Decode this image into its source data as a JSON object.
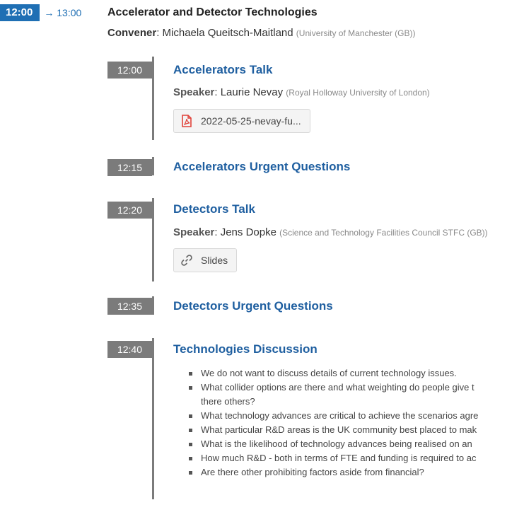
{
  "session": {
    "start": "12:00",
    "end": "→ 13:00",
    "title": "Accelerator and Detector Technologies",
    "convener_label": "Convener",
    "convener_name": "Michaela Queitsch-Maitland",
    "convener_affiliation": "(University of Manchester (GB))"
  },
  "contributions": [
    {
      "time": "12:00",
      "title": "Accelerators Talk",
      "speaker_label": "Speaker",
      "speaker_name": "Laurie Nevay",
      "speaker_affiliation": "(Royal Holloway University of London)",
      "attachment": {
        "label": "2022-05-25-nevay-fu...",
        "icon": "pdf-icon"
      }
    },
    {
      "time": "12:15",
      "title": "Accelerators Urgent Questions"
    },
    {
      "time": "12:20",
      "title": "Detectors Talk",
      "speaker_label": "Speaker",
      "speaker_name": "Jens Dopke",
      "speaker_affiliation": "(Science and Technology Facilities Council STFC (GB))",
      "attachment": {
        "label": "Slides",
        "icon": "link-icon"
      }
    },
    {
      "time": "12:35",
      "title": "Detectors Urgent Questions"
    },
    {
      "time": "12:40",
      "title": "Technologies Discussion",
      "bullets": [
        "We do not want to discuss details of current technology issues.",
        "What collider options are there and what weighting do people give t",
        "there others?",
        "What technology advances are critical to achieve the scenarios agre",
        "What particular R&D areas is the UK community best placed to mak",
        "What is the likelihood of technology advances being realised on an",
        "How much R&D - both in terms of FTE and funding is required to ac",
        "Are there other prohibiting factors aside from financial?"
      ]
    }
  ],
  "colors": {
    "accent": "#1f6fb4",
    "title_link": "#1f5fa0",
    "timeline_gray": "#7b7b7b",
    "pdf_red": "#e0423a"
  }
}
